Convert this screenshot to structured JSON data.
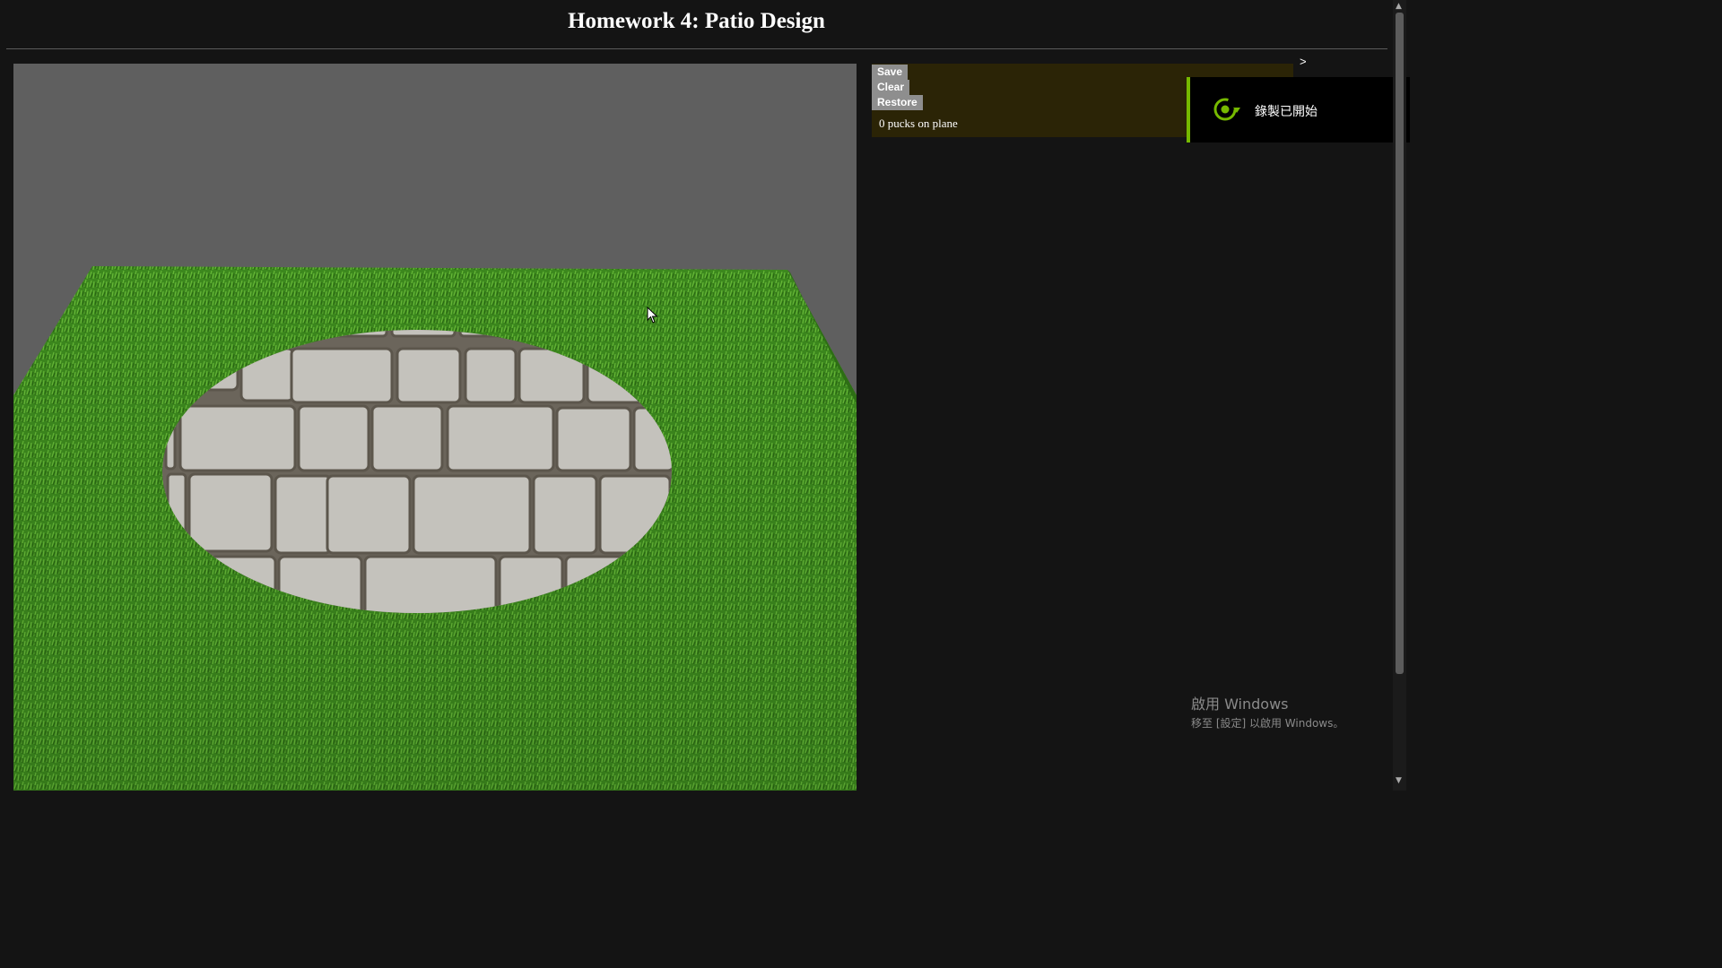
{
  "page": {
    "title": "Homework 4: Patio Design"
  },
  "panel": {
    "buttons": {
      "save": "Save",
      "clear": "Clear",
      "restore": "Restore"
    },
    "status": "0 pucks on plane",
    "toggle": ">"
  },
  "notification": {
    "text": "錄製已開始",
    "icon": "record-started-icon",
    "accent": "#76b900"
  },
  "watermark": {
    "title": "啟用 Windows",
    "subtitle": "移至 [設定] 以啟用 Windows。"
  },
  "scene": {
    "ground": "grass-plane",
    "patio": "circular-stone-paver-patio",
    "background": "#5f5f5f"
  },
  "colors": {
    "page_bg": "#141414",
    "panel_bg": "#2b2406",
    "button_bg": "#8e8e8e"
  }
}
